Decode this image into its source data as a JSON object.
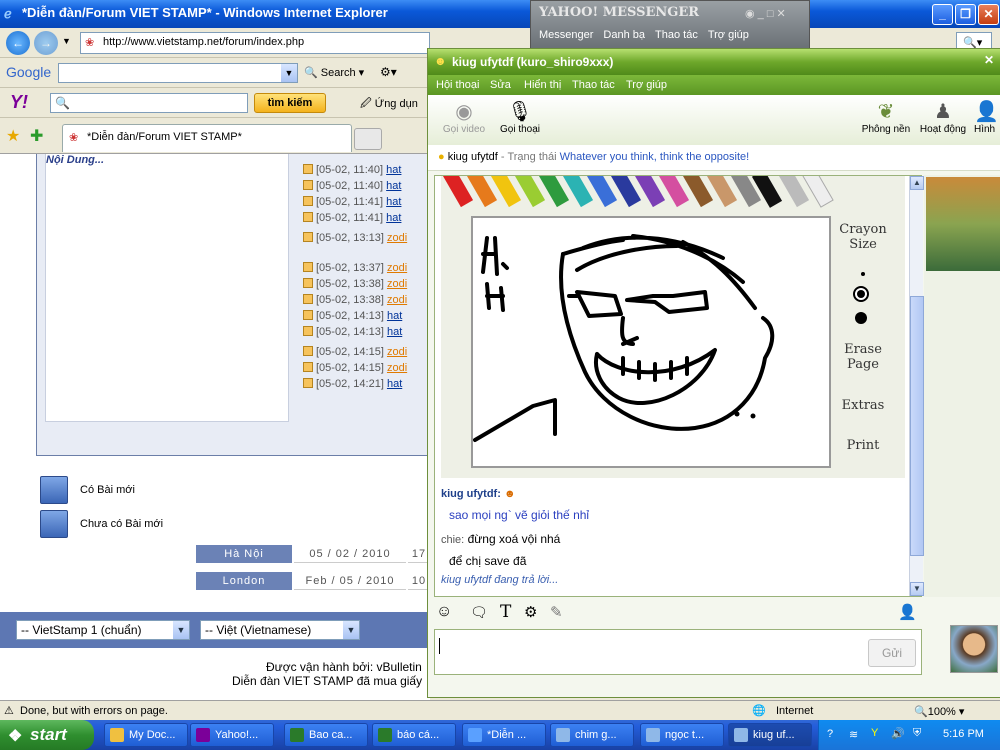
{
  "ie": {
    "title": "*Diễn đàn/Forum VIET STAMP* - Windows Internet Explorer",
    "url": "http://www.vietstamp.net/forum/index.php",
    "google_label": "Google",
    "search_label": "Search",
    "yahoo_search_button": "tìm kiếm",
    "ung_dung": "Ứng dụn",
    "tab_label": "*Diễn đàn/Forum VIET STAMP*",
    "status_text": "Done, but with errors on page.",
    "zone": "Internet",
    "zoom": "100%"
  },
  "forum": {
    "noi_dung": "Nội Dung...",
    "posts": [
      {
        "time": "[05-02, 11:40]",
        "user": "hat",
        "orange": false
      },
      {
        "time": "[05-02, 11:40]",
        "user": "hat",
        "orange": false
      },
      {
        "time": "[05-02, 11:41]",
        "user": "hat",
        "orange": false
      },
      {
        "time": "[05-02, 11:41]",
        "user": "hat",
        "orange": false
      },
      {
        "time": "[05-02, 13:13]",
        "user": "zodi",
        "orange": true
      },
      {
        "time": "[05-02, 13:37]",
        "user": "zodi",
        "orange": true
      },
      {
        "time": "[05-02, 13:38]",
        "user": "zodi",
        "orange": true
      },
      {
        "time": "[05-02, 13:38]",
        "user": "zodi",
        "orange": true
      },
      {
        "time": "[05-02, 14:13]",
        "user": "hat",
        "orange": false
      },
      {
        "time": "[05-02, 14:13]",
        "user": "hat",
        "orange": false
      },
      {
        "time": "[05-02, 14:15]",
        "user": "zodi",
        "orange": true
      },
      {
        "time": "[05-02, 14:15]",
        "user": "zodi",
        "orange": true
      },
      {
        "time": "[05-02, 14:21]",
        "user": "hat",
        "orange": false
      }
    ],
    "legend_new": "Có Bài mới",
    "legend_old": "Chưa có Bài mới",
    "time1_label": "Hà Nội",
    "time1_date": "05 / 02 / 2010",
    "time1_clock": "17",
    "time2_label": "London",
    "time2_date": "Feb / 05 / 2010",
    "time2_clock": "10",
    "style_select": "-- VietStamp 1 (chuẩn)",
    "lang_select": "-- Việt (Vietnamese)",
    "footer1": "Được vận hành bởi: vBulletin",
    "footer2": "Diễn đàn VIET STAMP đã mua giấy"
  },
  "ym_main": {
    "title": "YAHOO! MESSENGER",
    "menu": [
      "Messenger",
      "Danh bạ",
      "Thao tác",
      "Trợ giúp"
    ]
  },
  "chat": {
    "title": "kiug ufytdf (kuro_shiro9xxx)",
    "menu": [
      "Hội thoại",
      "Sửa",
      "Hiển thị",
      "Thao tác",
      "Trợ giúp"
    ],
    "tool_video": "Gọi video",
    "tool_voice": "Gọi thoại",
    "tool_bg": "Phông nền",
    "tool_activity": "Hoạt động",
    "tool_pic": "Hình",
    "contact": "kiug ufytdf",
    "status_prefix": "- Trạng thái",
    "status_msg": "Whatever you think, think the opposite!",
    "crayon_size": "Crayon Size",
    "erase_page": "Erase Page",
    "extras": "Extras",
    "print": "Print",
    "msg1_sender": "kiug ufytdf:",
    "msg1_text": "sao mọi ng` vẽ giỏi thế nhỉ",
    "msg2_sender": "chie:",
    "msg2_text": "đừng xoá vội nhá",
    "msg3_text": "để chị save đã",
    "typing": "kiug ufytdf đang trả lời...",
    "send": "Gửi"
  },
  "taskbar": {
    "start": "start",
    "tasks": [
      "My Doc...",
      "Yahoo!...",
      "Bao ca...",
      "báo cá...",
      "*Diễn ...",
      "chim g...",
      "ngọc t...",
      "kiug uf..."
    ],
    "clock": "5:16 PM"
  }
}
